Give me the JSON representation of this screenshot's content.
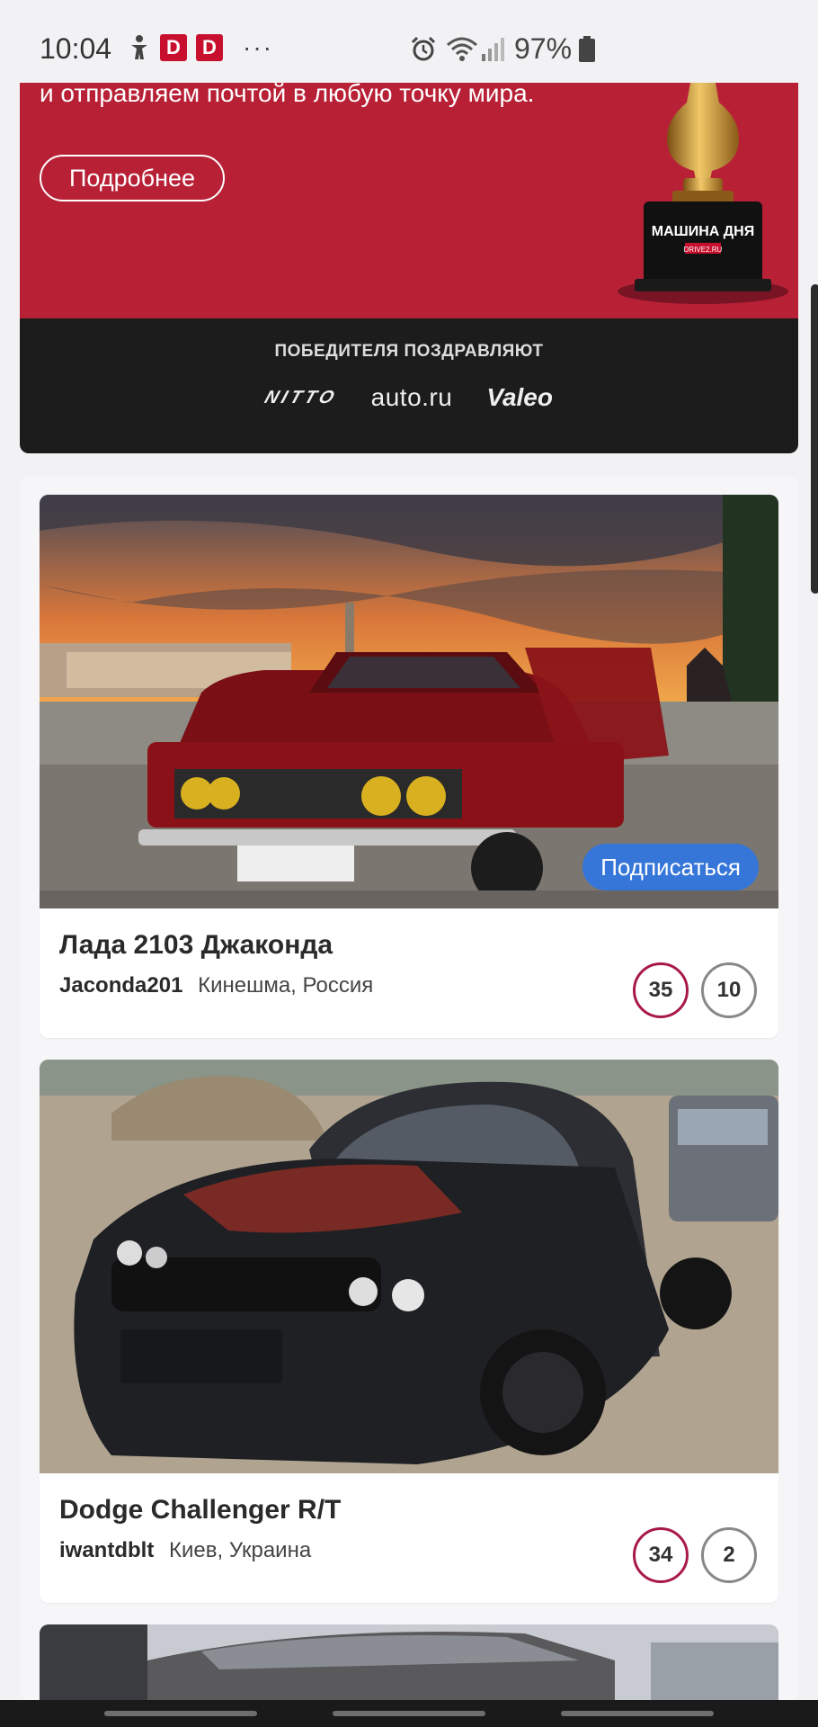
{
  "status_bar": {
    "time": "10:04",
    "battery": "97%",
    "left_badge_1": "D",
    "left_badge_2": "D",
    "more": "···"
  },
  "promo": {
    "text": "и отправляем почтой в любую точку мира.",
    "button_label": "Подробнее",
    "trophy_plaque": "МАШИНА ДНЯ",
    "trophy_sub": "DRIVE2.RU",
    "congrats_label": "ПОБЕДИТЕЛЯ ПОЗДРАВЛЯЮТ",
    "sponsors": [
      "NITTO",
      "auto.ru",
      "Valeo"
    ],
    "colors": {
      "red": "#b82036",
      "dark": "#1c1c1c"
    }
  },
  "feed": {
    "cards": [
      {
        "title": "Лада 2103 Джаконда",
        "user": "Jaconda201",
        "location": "Кинешма, Россия",
        "likes": "35",
        "comments": "10",
        "subscribe_label": "Подписаться",
        "image": "red-lada-2103-sunset-photo"
      },
      {
        "title": "Dodge Challenger R/T",
        "user": "iwantdblt",
        "location": "Киев, Украина",
        "likes": "34",
        "comments": "2",
        "image": "black-dodge-challenger-photo"
      }
    ],
    "colors": {
      "likes_ring": "#a8194a",
      "comments_ring": "#888888",
      "subscribe": "#3576d8"
    }
  }
}
